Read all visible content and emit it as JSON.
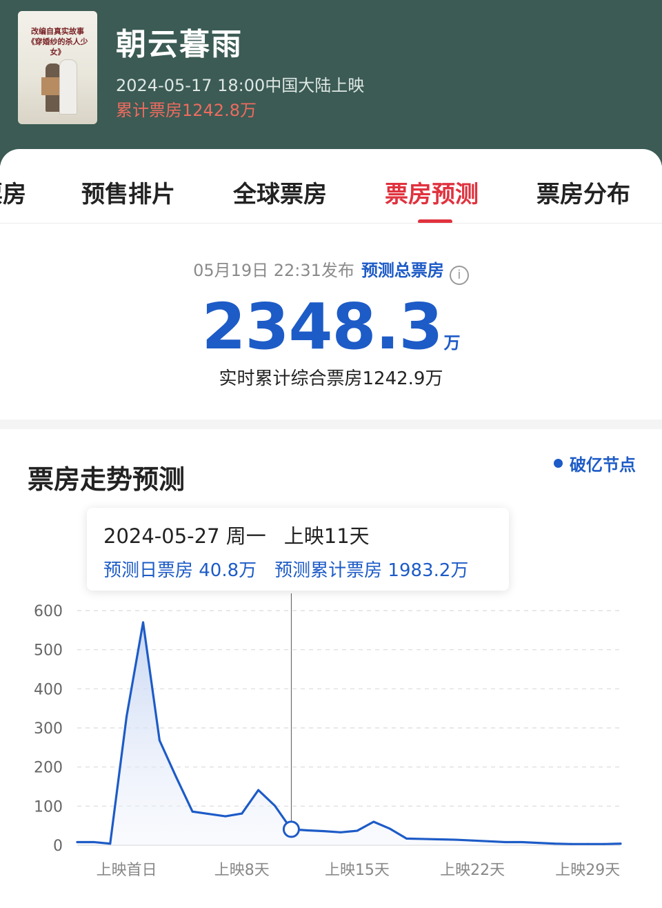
{
  "movie": {
    "poster_text_line1": "改编自真实故事",
    "poster_text_line2": "《穿婚纱的杀人少女》",
    "title": "朝云暮雨",
    "release": "2024-05-17 18:00中国大陆上映",
    "cumulative_box": "累计票房1242.8万"
  },
  "tabs": [
    {
      "label": "票房"
    },
    {
      "label": "预售排片"
    },
    {
      "label": "全球票房"
    },
    {
      "label": "票房预测",
      "active": true
    },
    {
      "label": "票房分布"
    }
  ],
  "prediction": {
    "published": "05月19日 22:31发布",
    "label": "预测总票房",
    "info_icon": "info-icon",
    "total_value": "2348.3",
    "total_unit": "万",
    "realtime": "实时累计综合票房1242.9万"
  },
  "trend": {
    "title": "票房走势预测",
    "legend": "破亿节点"
  },
  "tooltip": {
    "date": "2024-05-27 周一",
    "day": "上映11天",
    "daily": "预测日票房 40.8万",
    "cumulative": "预测累计票房 1983.2万"
  },
  "colors": {
    "header_bg": "#3b5b54",
    "accent_red": "#e0323e",
    "accent_blue": "#1d5bc7",
    "cumulative_red": "#ef6b5f"
  },
  "chart_data": {
    "type": "area",
    "xlabel": "",
    "ylabel": "",
    "ylim": [
      0,
      600
    ],
    "yticks": [
      0,
      100,
      200,
      300,
      400,
      500,
      600
    ],
    "grid": true,
    "x": [
      -2,
      -1,
      0,
      1,
      2,
      3,
      4,
      5,
      6,
      7,
      8,
      9,
      10,
      11,
      12,
      13,
      14,
      15,
      16,
      17,
      18,
      19,
      20,
      21,
      22,
      23,
      24,
      25,
      26,
      27,
      28,
      29,
      30,
      31
    ],
    "x_tick_labels": [
      {
        "x": 1,
        "label": "上映首日"
      },
      {
        "x": 8,
        "label": "上映8天"
      },
      {
        "x": 15,
        "label": "上映15天"
      },
      {
        "x": 22,
        "label": "上映22天"
      },
      {
        "x": 29,
        "label": "上映29天"
      }
    ],
    "series": [
      {
        "values": [
          8,
          8,
          4,
          330,
          570,
          268,
          175,
          86,
          80,
          74,
          81,
          141,
          101,
          40.8,
          38,
          36,
          33,
          37,
          60,
          42,
          17,
          16,
          15,
          14,
          12,
          10,
          8,
          8,
          6,
          4,
          3,
          3,
          3,
          4
        ]
      }
    ],
    "highlight": {
      "x": 11,
      "value": 40.8
    }
  }
}
